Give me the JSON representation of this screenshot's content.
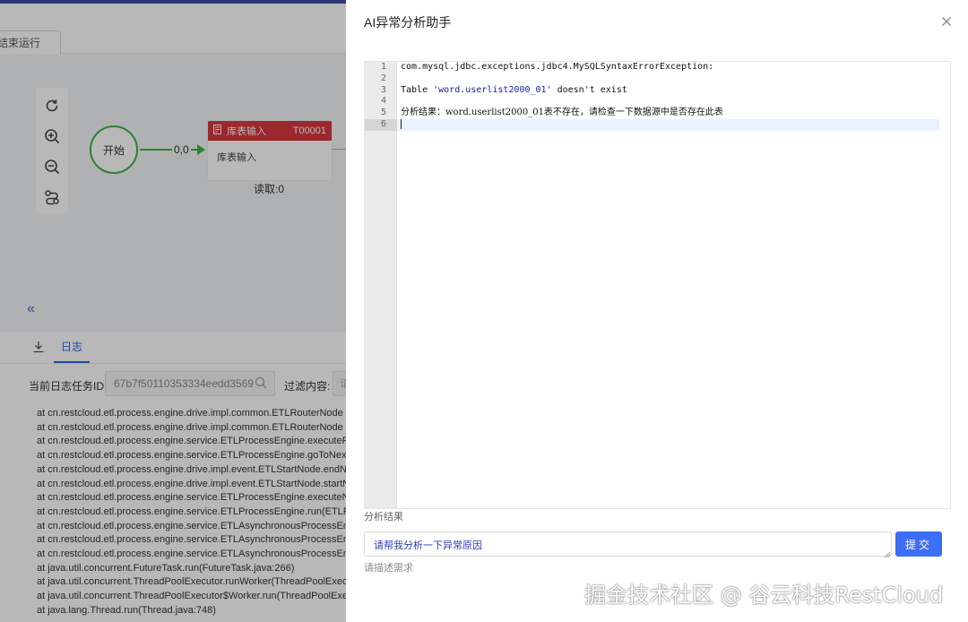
{
  "background": {
    "toolbar": {
      "stop_button_label": "结束运行"
    },
    "canvas": {
      "start_node_label": "开始",
      "edge_label": "0,0",
      "table_node": {
        "title": "库表输入",
        "id": "T00001",
        "body": "库表输入",
        "read_status": "读取:0"
      },
      "collapse_glyph": "«"
    },
    "log_panel": {
      "tab_label": "日志",
      "task_id_label": "当前日志任务ID:",
      "task_id_value": "67b7f50110353334eedd3569",
      "filter_label": "过滤内容:",
      "filter_placeholder": "请",
      "lines": [
        "at cn.restcloud.etl.process.engine.drive.impl.common.ETLRouterNode",
        "at cn.restcloud.etl.process.engine.drive.impl.common.ETLRouterNode",
        "at cn.restcloud.etl.process.engine.service.ETLProcessEngine.executeRo",
        "at cn.restcloud.etl.process.engine.service.ETLProcessEngine.goToNext",
        "at cn.restcloud.etl.process.engine.drive.impl.event.ETLStartNode.endN",
        "at cn.restcloud.etl.process.engine.drive.impl.event.ETLStartNode.startN",
        "at cn.restcloud.etl.process.engine.service.ETLProcessEngine.executeN",
        "at cn.restcloud.etl.process.engine.service.ETLProcessEngine.run(ETLPr",
        "at cn.restcloud.etl.process.engine.service.ETLAsynchronousProcessEng",
        "at cn.restcloud.etl.process.engine.service.ETLAsynchronousProcessEng",
        "at cn.restcloud.etl.process.engine.service.ETLAsynchronousProcessEng",
        "at java.util.concurrent.FutureTask.run(FutureTask.java:266)",
        "at java.util.concurrent.ThreadPoolExecutor.runWorker(ThreadPoolExec",
        "at java.util.concurrent.ThreadPoolExecutor$Worker.run(ThreadPoolExe",
        "at java.lang.Thread.run(Thread.java:748)"
      ]
    }
  },
  "drawer": {
    "title": "AI异常分析助手",
    "editor": {
      "line_numbers": [
        "1",
        "2",
        "3",
        "4",
        "5",
        "6"
      ],
      "line1": "com.mysql.jdbc.exceptions.jdbc4.MySQLSyntaxErrorException:",
      "line3_prefix": "Table ",
      "line3_string": "'word.userlist2000_01'",
      "line3_suffix": " doesn't exist",
      "line5": "分析结果：word.userlist2000_01表不存在，请检查一下数据源中是否存在此表",
      "active_line": 6
    },
    "result_label": "分析结果",
    "request_value": "请帮我分析一下异常原因",
    "submit_label": "提交",
    "desc_label": "请描述需求"
  },
  "watermark": "掘金技术社区 @ 谷云科技RestCloud",
  "colors": {
    "accent": "#3d6ef6",
    "node_red": "#d9363e",
    "start_green": "#3ab54a",
    "string_blue": "#1a1aa6"
  }
}
